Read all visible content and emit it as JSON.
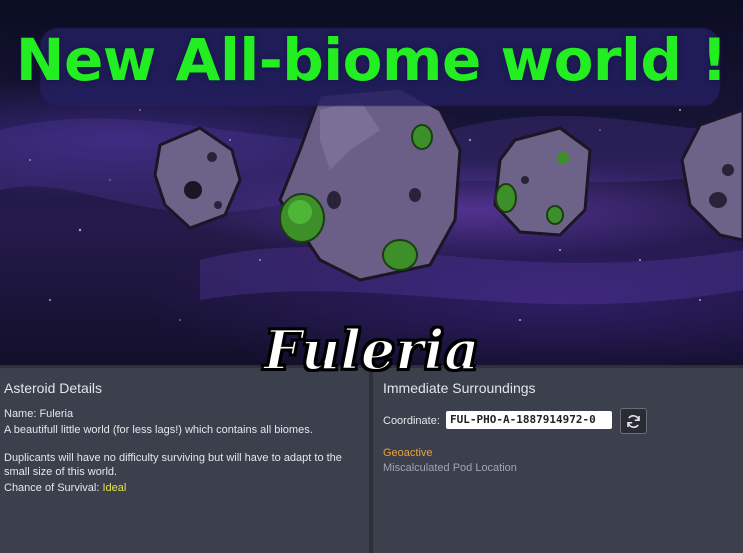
{
  "banner": {
    "headline": "New All-biome world !",
    "world_name": "Fuleria"
  },
  "asteroid_details": {
    "title": "Asteroid Details",
    "name_line": "Name: Fuleria",
    "description": "A beautifull little world (for less lags!) which contains all biomes.",
    "difficulty_line1": "Duplicants will have no difficulty surviving but will have to adapt to the",
    "difficulty_line2": "small size of this world.",
    "survival_label": "Chance of Survival: ",
    "survival_value": "Ideal"
  },
  "surroundings": {
    "title": "Immediate Surroundings",
    "coordinate_label": "Coordinate:",
    "coordinate_value": "FUL-PHO-A-1887914972-0",
    "traits": [
      "Geoactive",
      "Miscalculated Pod Location"
    ]
  },
  "colors": {
    "headline": "#22ee22",
    "trait_geoactive": "#e8a23a",
    "trait_pod": "#a3a6b0",
    "survival_ideal": "#e7e542"
  },
  "icons": {
    "reroll": "refresh-icon"
  }
}
